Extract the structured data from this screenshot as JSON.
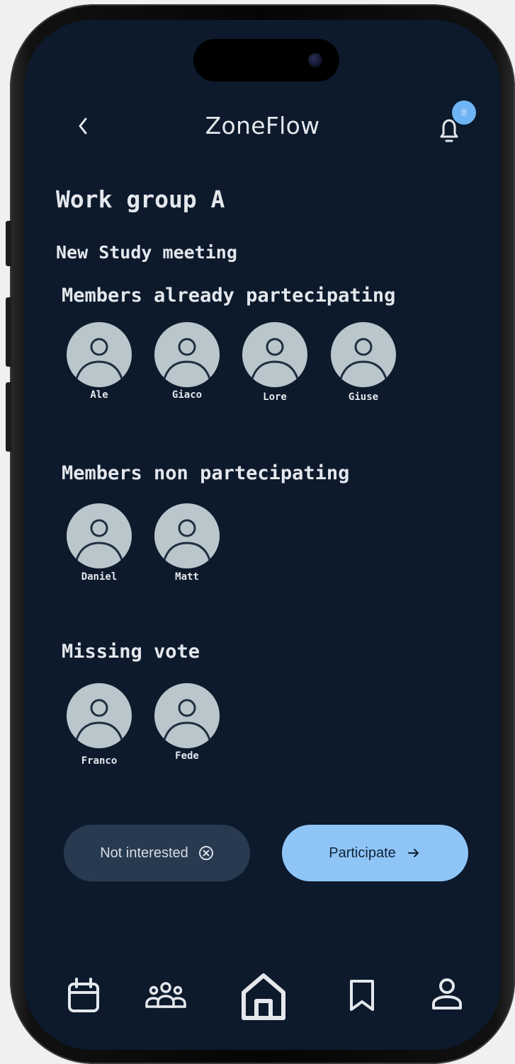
{
  "header": {
    "app_title": "ZoneFlow",
    "notification_badge": "8"
  },
  "group": {
    "name": "Work group A",
    "meeting_title": "New Study meeting"
  },
  "sections": {
    "participating": {
      "title": "Members already partecipating",
      "members": [
        "Ale",
        "Giaco",
        "Lore",
        "Giuse"
      ]
    },
    "non_participating": {
      "title": "Members non partecipating",
      "members": [
        "Daniel",
        "Matt"
      ]
    },
    "missing_vote": {
      "title": "Missing vote",
      "members": [
        "Franco",
        "Fede"
      ]
    }
  },
  "actions": {
    "not_interested_label": "Not interested",
    "participate_label": "Participate"
  },
  "bottom_nav": {
    "items": [
      "calendar-icon",
      "group-icon",
      "home-icon",
      "bookmark-icon",
      "profile-icon"
    ],
    "active": "home-icon"
  },
  "colors": {
    "background": "#0c1a2c",
    "accent": "#8fc4f6",
    "avatar": "#b9c6cc",
    "secondary_button": "#283a50"
  }
}
